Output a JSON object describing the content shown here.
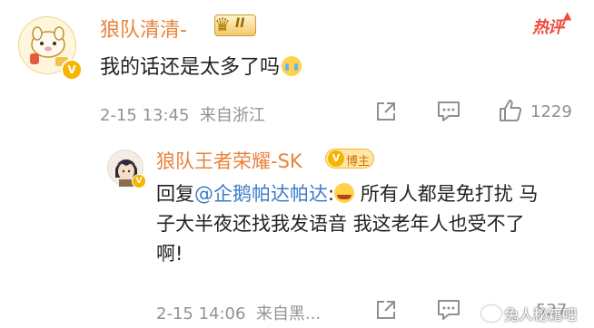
{
  "comment": {
    "username": "狼队清清-",
    "rank_badge": "II",
    "hot_tag": "热评",
    "text": "我的话还是太多了吗",
    "emoji": "crying-face",
    "date": "2-15 13:45",
    "location": "来自浙江",
    "likes": "1229"
  },
  "reply": {
    "username": "狼队王者荣耀-SK",
    "badge": "博主",
    "prefix": "回复",
    "mention": "@企鹅帕达帕达",
    "colon": ":",
    "emoji": "laughing-tears-face",
    "text": " 所有人都是免打扰 马子大半夜还找我发语音 我这老年人也受不了啊!",
    "date": "2-15 14:06",
    "location": "来自黑...",
    "likes": "527"
  },
  "watermark": "兔人秘籍吧",
  "colors": {
    "username": "#e8833a",
    "mention": "#3b7bc6",
    "hot": "#ee4b3a",
    "meta": "#939393"
  }
}
